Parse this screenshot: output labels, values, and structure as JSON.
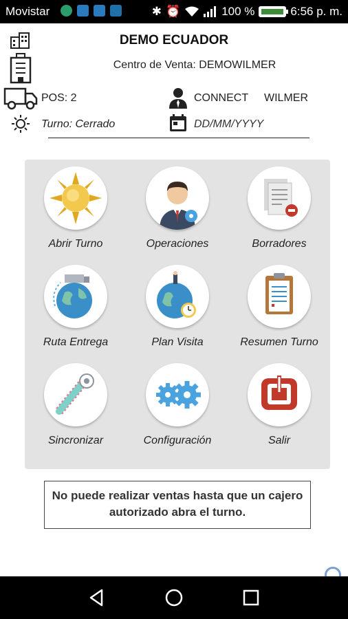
{
  "status_bar": {
    "carrier": "Movistar",
    "battery": "100 %",
    "time": "6:56 p. m.",
    "battery_level": 1.0
  },
  "header": {
    "company": "DEMO ECUADOR",
    "sales_center": "Centro de Venta: DEMOWILMER",
    "pos": "POS: 2",
    "connection": "CONNECT",
    "user": "WILMER",
    "shift": "Turno: Cerrado",
    "date_placeholder": "DD/MM/YYYY"
  },
  "menu": {
    "items": [
      {
        "label": "Abrir Turno",
        "icon": "sun-icon"
      },
      {
        "label": "Operaciones",
        "icon": "businessman-icon"
      },
      {
        "label": "Borradores",
        "icon": "drafts-icon"
      },
      {
        "label": "Ruta Entrega",
        "icon": "delivery-route-icon"
      },
      {
        "label": "Plan Visita",
        "icon": "visit-plan-icon"
      },
      {
        "label": "Resumen Turno",
        "icon": "clipboard-icon"
      },
      {
        "label": "Sincronizar",
        "icon": "sync-icon"
      },
      {
        "label": "Configuración",
        "icon": "gears-icon"
      },
      {
        "label": "Salir",
        "icon": "power-icon"
      }
    ]
  },
  "notice": "No puede realizar ventas hasta que un cajero autorizado abra el turno.",
  "colors": {
    "panel": "#e3e3e3",
    "exit_red": "#c0392b",
    "globe_blue": "#3a8fc9",
    "sun_yellow": "#f2c94c"
  }
}
